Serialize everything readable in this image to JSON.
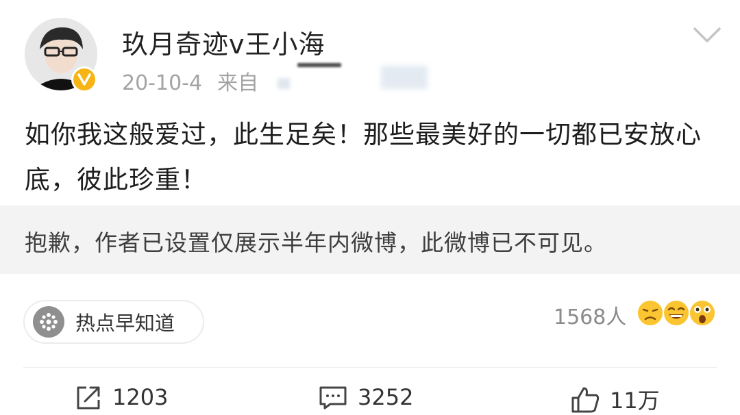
{
  "post": {
    "author": "玖月奇迹v王小海",
    "date": "20-10-4",
    "source_prefix": "来自",
    "text": "如你我这般爱过，此生足矣！那些最美好的一切都已安放心底，彼此珍重！"
  },
  "notice": {
    "text": "抱歉，作者已设置仅展示半年内微博，此微博已不可见。"
  },
  "topic": {
    "label": "热点早知道"
  },
  "reactions": {
    "count": "1568人"
  },
  "actions": {
    "repost_count": "1203",
    "comment_count": "3252",
    "like_count": "11万"
  },
  "colors": {
    "verified_badge": "#f6b515",
    "notice_bg": "#f3f3f3",
    "meta_text": "#a3a3a3"
  },
  "icons": [
    "avatar-photo",
    "verified-badge-icon",
    "chevron-down-icon",
    "topic-icon",
    "emoji-icons",
    "repost-icon",
    "comment-icon",
    "like-icon"
  ]
}
